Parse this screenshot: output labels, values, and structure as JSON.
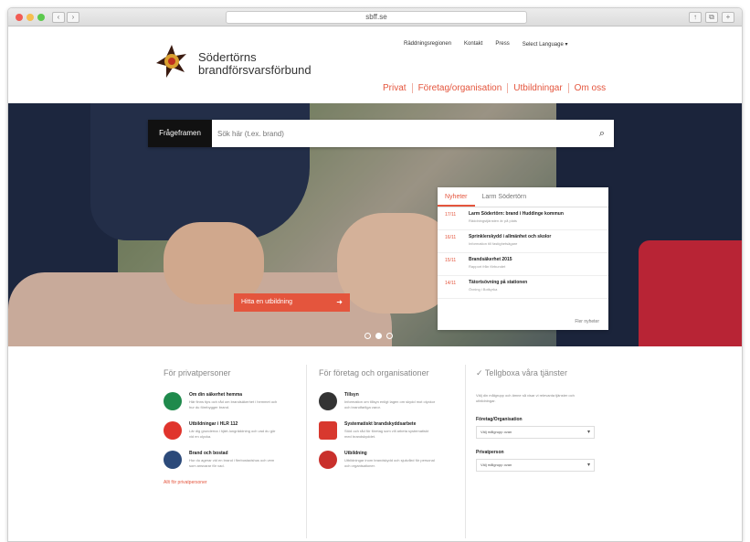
{
  "browser": {
    "url": "sbff.se"
  },
  "header": {
    "brand_line1": "Södertörns",
    "brand_line2": "brandförsvarsförbund",
    "topnav": [
      "Räddningsregionen",
      "Kontakt",
      "Press",
      "Select Language"
    ],
    "mainnav": [
      "Privat",
      "Företag/organisation",
      "Utbildningar",
      "Om oss"
    ]
  },
  "hero": {
    "search_label": "Frågeframen",
    "search_placeholder": "Sök här (t.ex. brand)",
    "cta_label": "Hitta en utbildning",
    "news_tabs": [
      "Nyheter",
      "Larm Södertörn"
    ],
    "news_items": [
      {
        "date": "17/11",
        "title": "Larm Södertörn: brand i Huddinge kommun",
        "sub": "Räddningstjänsten är på plats"
      },
      {
        "date": "16/11",
        "title": "Sprinklerskydd i allmänhet och skolor",
        "sub": "Information till fastighetsägare"
      },
      {
        "date": "15/11",
        "title": "Brandsäkerhet 2015",
        "sub": "Rapport från förbundet"
      },
      {
        "date": "14/11",
        "title": "Tätortsövning på stationen",
        "sub": "Övning i Botkyrka"
      }
    ],
    "news_more": "Fler nyheter"
  },
  "content": {
    "col1": {
      "heading": "För privatpersoner",
      "items": [
        {
          "title": "Om din säkerhet hemma",
          "desc": "Här finns tips och råd om brandsäkerhet i hemmet och hur du förebygger brand."
        },
        {
          "title": "Utbildningar i HLR 112",
          "desc": "Lär dig grunderna i hjärt-lungräddning och vad du gör vid en olycka."
        },
        {
          "title": "Brand och bostad",
          "desc": "Hur du agerar vid en brand i flerbostadshus och vem som ansvarar för vad."
        }
      ],
      "footer": "Allt för privatpersoner"
    },
    "col2": {
      "heading": "För företag och organisationer",
      "items": [
        {
          "title": "Tillsyn",
          "desc": "Information om tillsyn enligt lagen om skydd mot olyckor och brandfarliga varor."
        },
        {
          "title": "Systematiskt brandskyddsarbete",
          "desc": "Stöd och råd för företag som vill arbeta systematiskt med brandskyddet."
        },
        {
          "title": "Utbildning",
          "desc": "Utbildningar inom brandskydd och sjukvård för personal och organisationer."
        }
      ]
    },
    "col3": {
      "heading": "Tellgboxa våra tjänster",
      "hint": "Välj din målgrupp och ämne så visar vi relevanta tjänster och utbildningar.",
      "field1_label": "Företag/Organisation",
      "field1_value": "Välj målgrupp ovan",
      "field2_label": "Privatperson",
      "field2_value": "Välj målgrupp ovan"
    }
  },
  "colors": {
    "accent": "#e4553d"
  }
}
